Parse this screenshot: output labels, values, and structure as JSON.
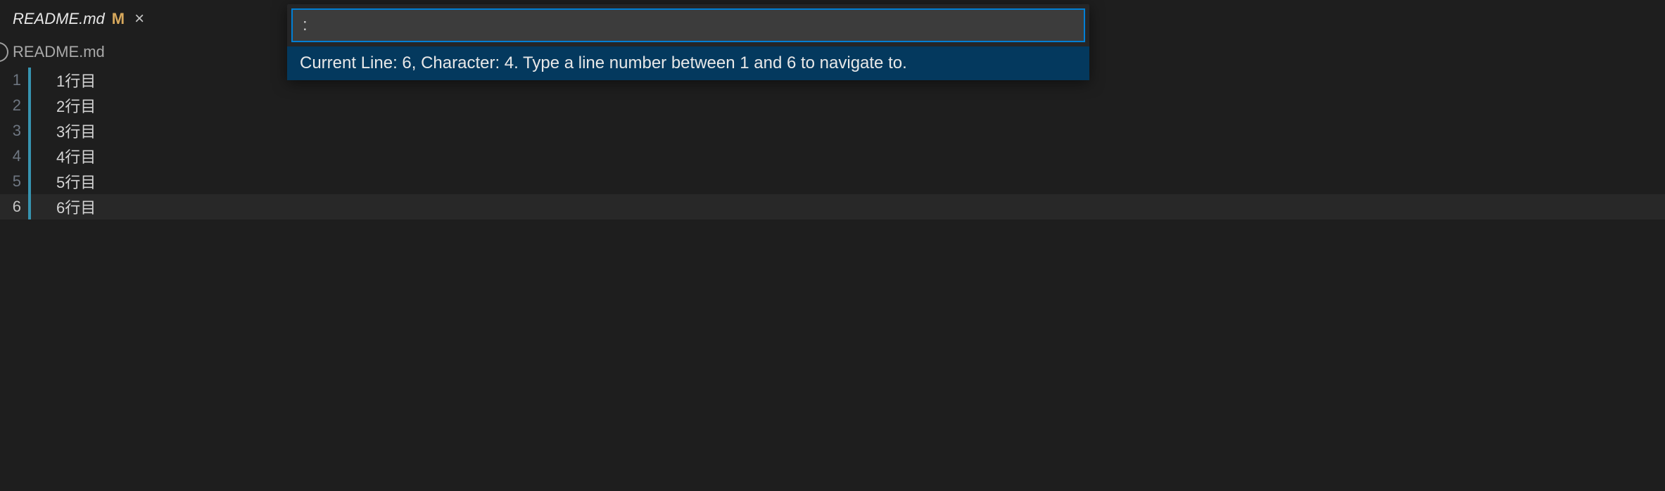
{
  "tab": {
    "filename": "README.md",
    "modified_indicator": "M",
    "close_glyph": "×"
  },
  "breadcrumb": {
    "filename": "README.md"
  },
  "editor": {
    "current_line": 6,
    "lines": [
      {
        "num": "1",
        "text": "1行目"
      },
      {
        "num": "2",
        "text": "2行目"
      },
      {
        "num": "3",
        "text": "3行目"
      },
      {
        "num": "4",
        "text": "4行目"
      },
      {
        "num": "5",
        "text": "5行目"
      },
      {
        "num": "6",
        "text": "6行目"
      }
    ]
  },
  "quick_input": {
    "value": ":",
    "hint": "Current Line: 6, Character: 4. Type a line number between 1 and 6 to navigate to."
  }
}
